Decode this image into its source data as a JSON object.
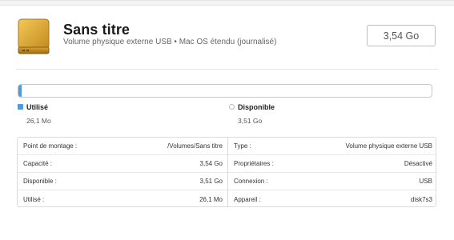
{
  "header": {
    "title": "Sans titre",
    "subtitle": "Volume physique externe USB • Mac OS étendu (journalisé)",
    "capacity": "3,54 Go",
    "icon": "external-drive-icon"
  },
  "usage": {
    "used_fraction": 0.0074,
    "used_color": "#4f9ad8",
    "used_label": "Utilisé",
    "used_value": "26,1 Mo",
    "free_label": "Disponible",
    "free_value": "3,51 Go"
  },
  "info": {
    "left": [
      {
        "label": "Point de montage :",
        "value": "/Volumes/Sans titre"
      },
      {
        "label": "Capacité :",
        "value": "3,54 Go"
      },
      {
        "label": "Disponible :",
        "value": "3,51 Go"
      },
      {
        "label": "Utilisé :",
        "value": "26,1 Mo"
      }
    ],
    "right": [
      {
        "label": "Type :",
        "value": "Volume physique externe USB"
      },
      {
        "label": "Propriétaires :",
        "value": "Désactivé"
      },
      {
        "label": "Connexion :",
        "value": "USB"
      },
      {
        "label": "Appareil :",
        "value": "disk7s3"
      }
    ]
  }
}
